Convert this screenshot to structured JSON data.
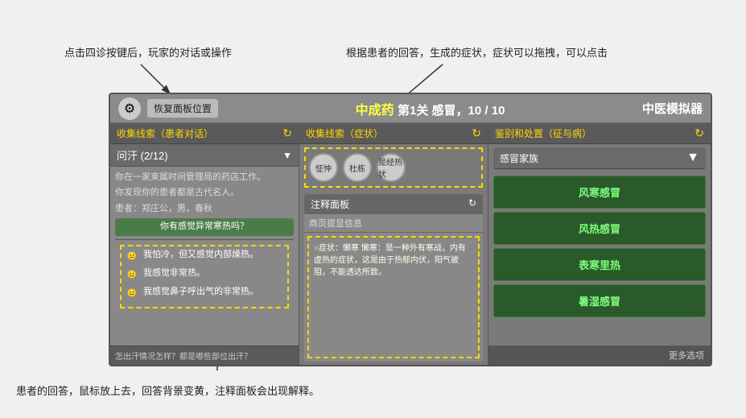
{
  "annotations": {
    "top_left": "点击四诊按键后，玩家的对话或操作",
    "top_right": "根据患者的回答，生成的症状，症状可以拖拽，可以点击",
    "bottom": "患者的回答，鼠标放上去，回答背景变黄，注释面板会出现解释。"
  },
  "header": {
    "gear_label": "⚙",
    "restore_label": "恢复面板位置",
    "title_part1": "中成药",
    "title_part2": " 第1关 感冒，10 / 10",
    "title_right": "中医模拟器"
  },
  "left_col": {
    "header": "收集线索（患者对话）",
    "dropdown_label": "问汗 (2/12)",
    "messages": [
      "你在一家束属时间管理局的药店工作。",
      "你发现你的患者都是古代名人。",
      "患者：郑庄公，男，春秋",
      "你有感觉异常寒热吗？",
      "我怕冷，但又感觉内部燥热。",
      "我感觉非常热。",
      "我感觉鼻子呼出气的非常热。"
    ],
    "bottom_prompt": "怎出汗情况怎样？都是哪些部位出汗？"
  },
  "mid_col": {
    "header": "收集线索（症状）",
    "tags": [
      "怔忡",
      "杜栋",
      "是经热状"
    ],
    "info_panel_title": "注释面板",
    "info_panel_sub": "商页提显信息",
    "info_content": "○症状：懒寒\n懒寒：是一种外有寒战，内有虚热的症状，这是由于热郁内伏，阳气被阻，不能透达所致。"
  },
  "right_col": {
    "header": "鉴别和处置（征与病）",
    "dropdown": "感冒家族",
    "items": [
      "风寒感冒",
      "风热感冒",
      "表寒里热",
      "暑湿感冒"
    ],
    "more": "更多选项"
  }
}
